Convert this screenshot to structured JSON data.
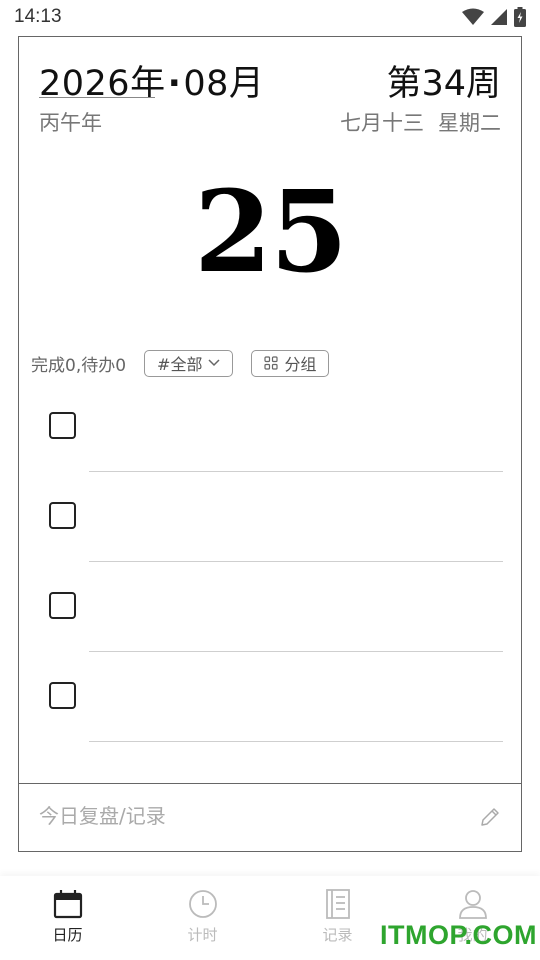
{
  "status_bar": {
    "time": "14:13"
  },
  "header": {
    "year_text": "2026年",
    "month_text": "08月",
    "week_text": "第34周",
    "ganzhi": "丙午年",
    "lunar_date": "七月十三",
    "weekday": "星期二"
  },
  "day_number": "25",
  "todo": {
    "summary": "完成0,待办0",
    "filter_label": "#全部",
    "group_label": "分组",
    "items": [
      "",
      "",
      "",
      ""
    ]
  },
  "review": {
    "placeholder": "今日复盘/记录"
  },
  "nav": {
    "calendar": "日历",
    "timer": "计时",
    "records": "记录",
    "mine": "我的"
  },
  "watermark": "ITMOP.COM"
}
